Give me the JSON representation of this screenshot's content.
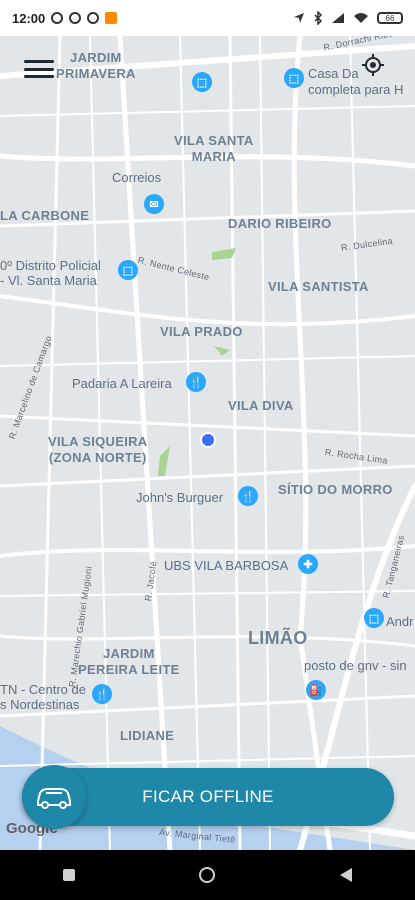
{
  "status_bar": {
    "time": "12:00",
    "battery": "66"
  },
  "map": {
    "labels": {
      "jardim_primavera": "JARDIM\nPRIMAVERA",
      "vila_santa_maria": "VILA SANTA\nMARIA",
      "correios": "Correios",
      "la_carbone": "LA CARBONE",
      "dario_ribeiro": "DARIO RIBEIRO",
      "distrito_policial": "0º Distrito Policial\n- Vl. Santa Maria",
      "vila_santista": "VILA SANTISTA",
      "vila_prado": "VILA PRADO",
      "padaria": "Padaria A Lareira",
      "vila_diva": "VILA DIVA",
      "vila_siqueira": "VILA SIQUEIRA\n(ZONA NORTE)",
      "johns_burguer": "John's Burguer",
      "sitio_do_morro": "SÍTIO DO MORRO",
      "ubs_vila_barbosa": "UBS VILA BARBOSA",
      "limao": "LIMÃO",
      "jardim_pereira_leite": "JARDIM\nPEREIRA LEITE",
      "posto_gnv": "posto de gnv - sin",
      "ctn": "TN - Centro de\ns Nordestinas",
      "lidiane": "LIDIANE",
      "casa_da": "Casa Da",
      "completa_para": "completa para H",
      "andr": "Andr"
    },
    "streets": {
      "r_dorrachi": "R. Dorrachi Ribeiro",
      "nente_celeste": "R. Nente Celeste",
      "dulcelina": "R. Dulcelina",
      "marcelino": "R. Marcelino de Camargo",
      "rocha_lima": "R. Rocha Lima",
      "gabriel": "R. Marechio Gabriel Mugioni",
      "jacofe": "R. Jacofé",
      "tanganeiras": "R. Tanganeiras",
      "marginal": "Av. Marginal Tietê"
    },
    "google": "Google"
  },
  "offline_button": {
    "label": "FICAR OFFLINE"
  },
  "colors": {
    "accent": "#1f87a8",
    "user_dot": "#3b6ff4",
    "poi": "#2aa7ff"
  }
}
